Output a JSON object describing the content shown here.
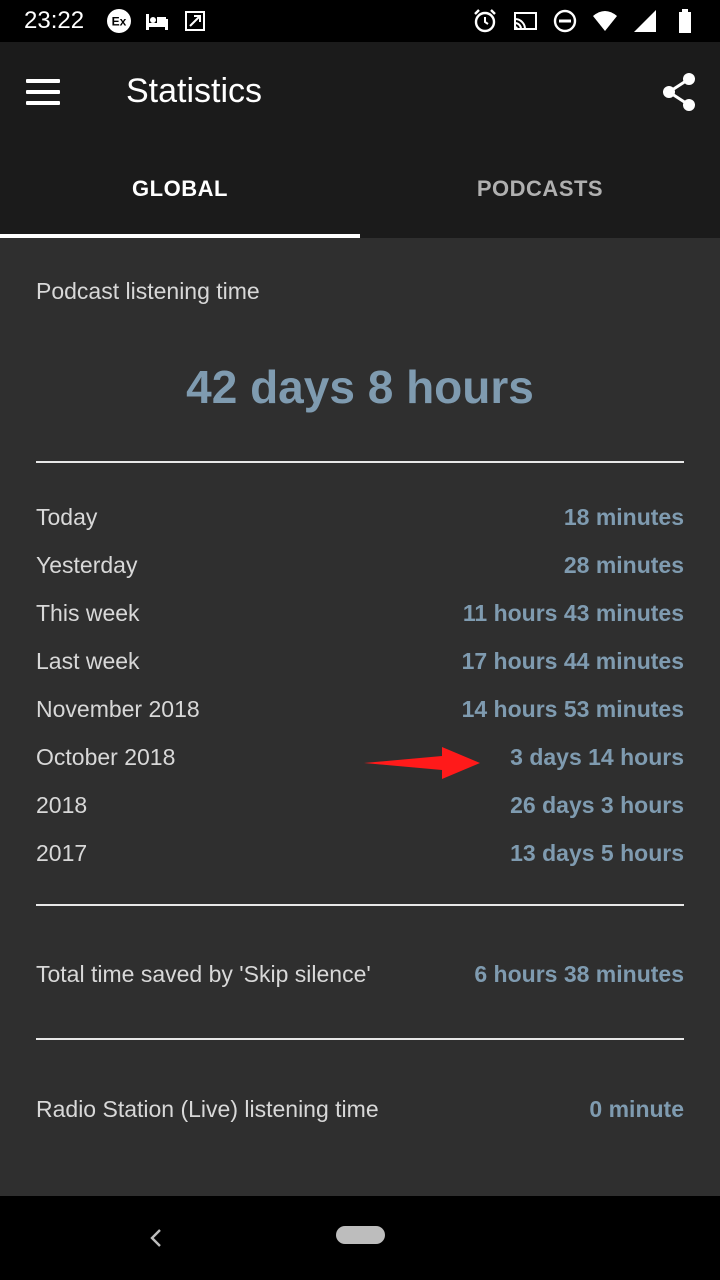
{
  "status_bar": {
    "time": "23:22",
    "left_icons": [
      "exchange-icon",
      "hotel-icon",
      "screenshot-icon"
    ],
    "right_icons": [
      "alarm-icon",
      "cast-icon",
      "dnd-icon",
      "wifi-icon",
      "signal-icon",
      "battery-icon"
    ]
  },
  "app_bar": {
    "title": "Statistics",
    "menu_icon": "menu-icon",
    "share_icon": "share-icon"
  },
  "tabs": [
    {
      "label": "GLOBAL",
      "active": true
    },
    {
      "label": "PODCASTS",
      "active": false
    }
  ],
  "stats": {
    "section_title": "Podcast listening time",
    "total": "42 days 8 hours",
    "rows": [
      {
        "label": "Today",
        "value": "18 minutes"
      },
      {
        "label": "Yesterday",
        "value": "28 minutes"
      },
      {
        "label": "This week",
        "value": "11 hours 43 minutes"
      },
      {
        "label": "Last week",
        "value": "17 hours 44 minutes"
      },
      {
        "label": "November 2018",
        "value": "14 hours 53 minutes"
      },
      {
        "label": "October 2018",
        "value": "3 days 14 hours"
      },
      {
        "label": "2018",
        "value": "26 days 3 hours"
      },
      {
        "label": "2017",
        "value": "13 days 5 hours"
      }
    ],
    "skip_silence": {
      "label": "Total time saved by 'Skip silence'",
      "value": "6 hours 38 minutes"
    },
    "radio": {
      "label": "Radio Station (Live) listening time",
      "value": "0 minute"
    }
  },
  "colors": {
    "accent": "#7f9bb0",
    "background": "#2f2f2f",
    "appbar": "#1b1b1b",
    "annotation_arrow": "#ff1a1a"
  },
  "nav_bar": {
    "back_icon": "back-icon",
    "home_icon": "home-pill-icon"
  }
}
